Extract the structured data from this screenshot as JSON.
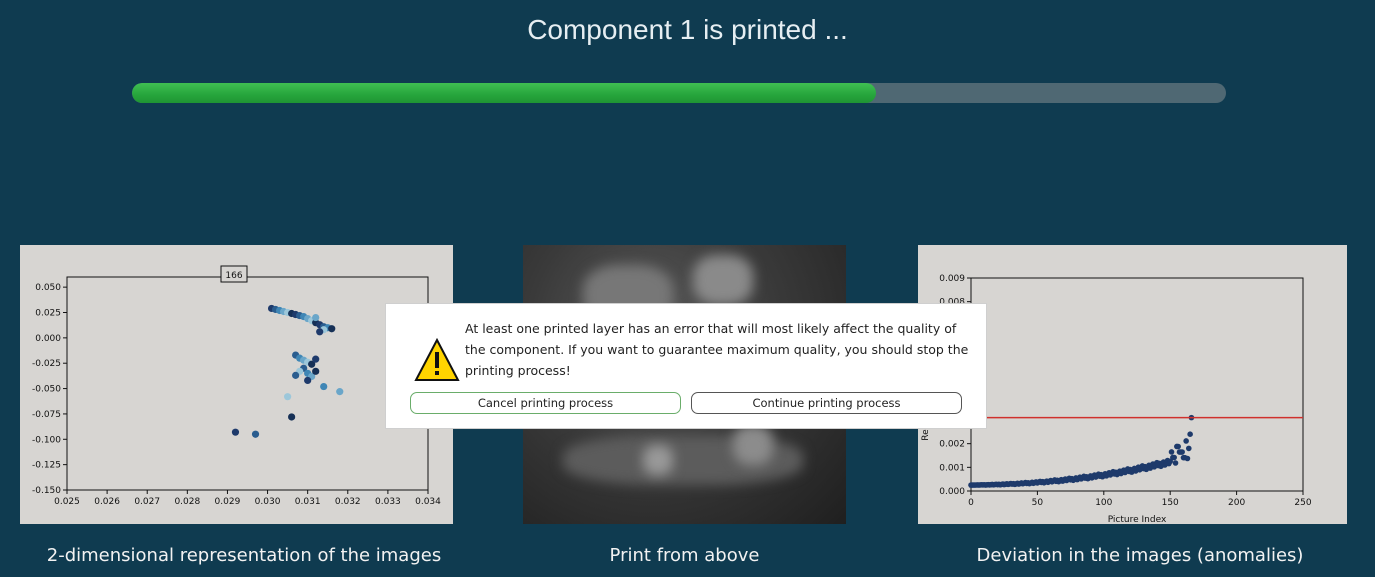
{
  "header": {
    "title": "Component 1 is printed ...",
    "progress_fraction": 0.68
  },
  "colors": {
    "background": "#0f3b50",
    "progress_fill": "#2fb047",
    "progress_track": "#4f6873",
    "threshold_line": "#d0312d",
    "scatter_dark": "#1e3a6b"
  },
  "captions": {
    "left": "2-dimensional representation of the images",
    "middle": "Print from above",
    "right": "Deviation in the images (anomalies)"
  },
  "dialog": {
    "icon": "warning-triangle-icon",
    "message": "At least one printed layer has an error that will most likely affect the quality of the component. If you want to guarantee maximum quality, you should stop the printing process!",
    "cancel_label": "Cancel printing process",
    "continue_label": "Continue printing process"
  },
  "chart_data": [
    {
      "type": "scatter",
      "annotation": "166",
      "xlim": [
        0.025,
        0.034
      ],
      "ylim": [
        -0.15,
        0.06
      ],
      "xticks": [
        "0.025",
        "0.026",
        "0.027",
        "0.028",
        "0.029",
        "0.030",
        "0.031",
        "0.032",
        "0.033",
        "0.034"
      ],
      "yticks": [
        "0.050",
        "0.025",
        "0.000",
        "-0.025",
        "-0.050",
        "-0.075",
        "-0.100",
        "-0.125",
        "-0.150"
      ],
      "points": [
        [
          0.0301,
          0.029
        ],
        [
          0.0302,
          0.028
        ],
        [
          0.0303,
          0.027
        ],
        [
          0.0304,
          0.026
        ],
        [
          0.0305,
          0.025
        ],
        [
          0.0306,
          0.024
        ],
        [
          0.0307,
          0.023
        ],
        [
          0.0308,
          0.022
        ],
        [
          0.0309,
          0.021
        ],
        [
          0.031,
          0.019
        ],
        [
          0.0311,
          0.017
        ],
        [
          0.0312,
          0.015
        ],
        [
          0.0313,
          0.013
        ],
        [
          0.0314,
          0.011
        ],
        [
          0.0315,
          0.01
        ],
        [
          0.0312,
          0.02
        ],
        [
          0.0314,
          0.008
        ],
        [
          0.0316,
          0.009
        ],
        [
          0.0313,
          0.006
        ],
        [
          0.0307,
          -0.017
        ],
        [
          0.0308,
          -0.02
        ],
        [
          0.0309,
          -0.022
        ],
        [
          0.031,
          -0.024
        ],
        [
          0.0311,
          -0.026
        ],
        [
          0.0312,
          -0.021
        ],
        [
          0.0309,
          -0.03
        ],
        [
          0.031,
          -0.035
        ],
        [
          0.0311,
          -0.038
        ],
        [
          0.0308,
          -0.033
        ],
        [
          0.0312,
          -0.033
        ],
        [
          0.031,
          -0.042
        ],
        [
          0.0307,
          -0.037
        ],
        [
          0.0314,
          -0.048
        ],
        [
          0.0318,
          -0.053
        ],
        [
          0.0305,
          -0.058
        ],
        [
          0.0306,
          -0.078
        ],
        [
          0.0292,
          -0.093
        ],
        [
          0.0297,
          -0.095
        ]
      ]
    },
    {
      "type": "scatter",
      "xlabel": "Picture Index",
      "ylabel": "Re",
      "xlim": [
        0,
        250
      ],
      "ylim": [
        0,
        0.009
      ],
      "xticks": [
        "0",
        "50",
        "100",
        "150",
        "200",
        "250"
      ],
      "yticks": [
        "0.009",
        "0.008",
        "0.002",
        "0.001",
        "0.000"
      ],
      "threshold": 0.0031,
      "points_description_index_range": [
        0,
        166
      ]
    }
  ]
}
